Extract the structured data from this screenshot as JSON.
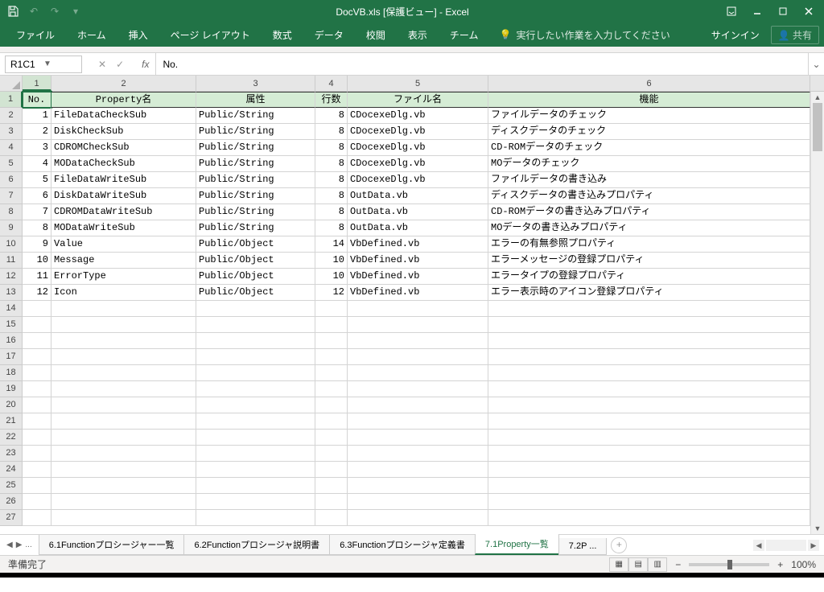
{
  "title": "DocVB.xls [保護ビュー] - Excel",
  "qat": {
    "save": "💾"
  },
  "ribbon": {
    "tabs": [
      "ファイル",
      "ホーム",
      "挿入",
      "ページ レイアウト",
      "数式",
      "データ",
      "校閲",
      "表示",
      "チーム"
    ],
    "tellme": "実行したい作業を入力してください",
    "signin": "サインイン",
    "share": "共有"
  },
  "namebox": "R1C1",
  "formula": "No.",
  "cols": [
    "1",
    "2",
    "3",
    "4",
    "5",
    "6"
  ],
  "headers": {
    "no": "No.",
    "prop": "Property名",
    "attr": "属性",
    "lines": "行数",
    "file": "ファイル名",
    "func": "機能"
  },
  "rows": [
    {
      "no": "1",
      "prop": "FileDataCheckSub",
      "attr": "Public/String",
      "lines": "8",
      "file": "CDocexeDlg.vb",
      "func": "ファイルデータのチェック"
    },
    {
      "no": "2",
      "prop": "DiskCheckSub",
      "attr": "Public/String",
      "lines": "8",
      "file": "CDocexeDlg.vb",
      "func": "ディスクデータのチェック"
    },
    {
      "no": "3",
      "prop": "CDROMCheckSub",
      "attr": "Public/String",
      "lines": "8",
      "file": "CDocexeDlg.vb",
      "func": "CD-ROMデータのチェック"
    },
    {
      "no": "4",
      "prop": "MODataCheckSub",
      "attr": "Public/String",
      "lines": "8",
      "file": "CDocexeDlg.vb",
      "func": "MOデータのチェック"
    },
    {
      "no": "5",
      "prop": "FileDataWriteSub",
      "attr": "Public/String",
      "lines": "8",
      "file": "CDocexeDlg.vb",
      "func": "ファイルデータの書き込み"
    },
    {
      "no": "6",
      "prop": "DiskDataWriteSub",
      "attr": "Public/String",
      "lines": "8",
      "file": "OutData.vb",
      "func": "ディスクデータの書き込みプロパティ"
    },
    {
      "no": "7",
      "prop": "CDROMDataWriteSub",
      "attr": "Public/String",
      "lines": "8",
      "file": "OutData.vb",
      "func": "CD-ROMデータの書き込みプロパティ"
    },
    {
      "no": "8",
      "prop": "MODataWriteSub",
      "attr": "Public/String",
      "lines": "8",
      "file": "OutData.vb",
      "func": "MOデータの書き込みプロパティ"
    },
    {
      "no": "9",
      "prop": "Value",
      "attr": "Public/Object",
      "lines": "14",
      "file": "VbDefined.vb",
      "func": "エラーの有無参照プロパティ"
    },
    {
      "no": "10",
      "prop": "Message",
      "attr": "Public/Object",
      "lines": "10",
      "file": "VbDefined.vb",
      "func": "エラーメッセージの登録プロパティ"
    },
    {
      "no": "11",
      "prop": "ErrorType",
      "attr": "Public/Object",
      "lines": "10",
      "file": "VbDefined.vb",
      "func": "エラータイプの登録プロパティ"
    },
    {
      "no": "12",
      "prop": "Icon",
      "attr": "Public/Object",
      "lines": "12",
      "file": "VbDefined.vb",
      "func": "エラー表示時のアイコン登録プロパティ"
    }
  ],
  "emptyRows": 14,
  "sheets": {
    "more": "...",
    "list": [
      "6.1Functionプロシージャー一覧",
      "6.2Functionプロシージャ説明書",
      "6.3Functionプロシージャ定義書",
      "7.1Property一覧",
      "7.2P ..."
    ],
    "active": 3
  },
  "status": {
    "ready": "準備完了",
    "zoom": "100%"
  }
}
